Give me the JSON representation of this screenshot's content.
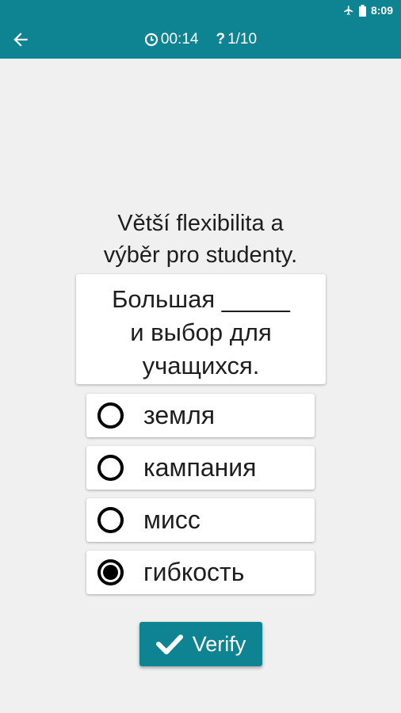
{
  "status_bar": {
    "icons": [
      "airplane-icon",
      "battery-icon"
    ],
    "time": "8:09"
  },
  "app_bar": {
    "back_icon": "arrow-left-icon",
    "timer_icon": "clock-icon",
    "timer": "00:14",
    "progress_icon": "question-mark-icon",
    "progress": "1/10"
  },
  "question": {
    "prompt_lines": [
      "Větší flexibilita a",
      "výběr pro studenty."
    ],
    "sentence_lines": [
      "Большая _____",
      "и выбор для",
      "учащихся."
    ]
  },
  "options": [
    {
      "label": "земля",
      "selected": false
    },
    {
      "label": "кампания",
      "selected": false
    },
    {
      "label": "мисс",
      "selected": false
    },
    {
      "label": "гибкость",
      "selected": true
    }
  ],
  "verify_button": {
    "label": "Verify",
    "icon": "checkmark-icon"
  },
  "colors": {
    "accent": "#0e8391",
    "background": "#f0f0f0"
  }
}
